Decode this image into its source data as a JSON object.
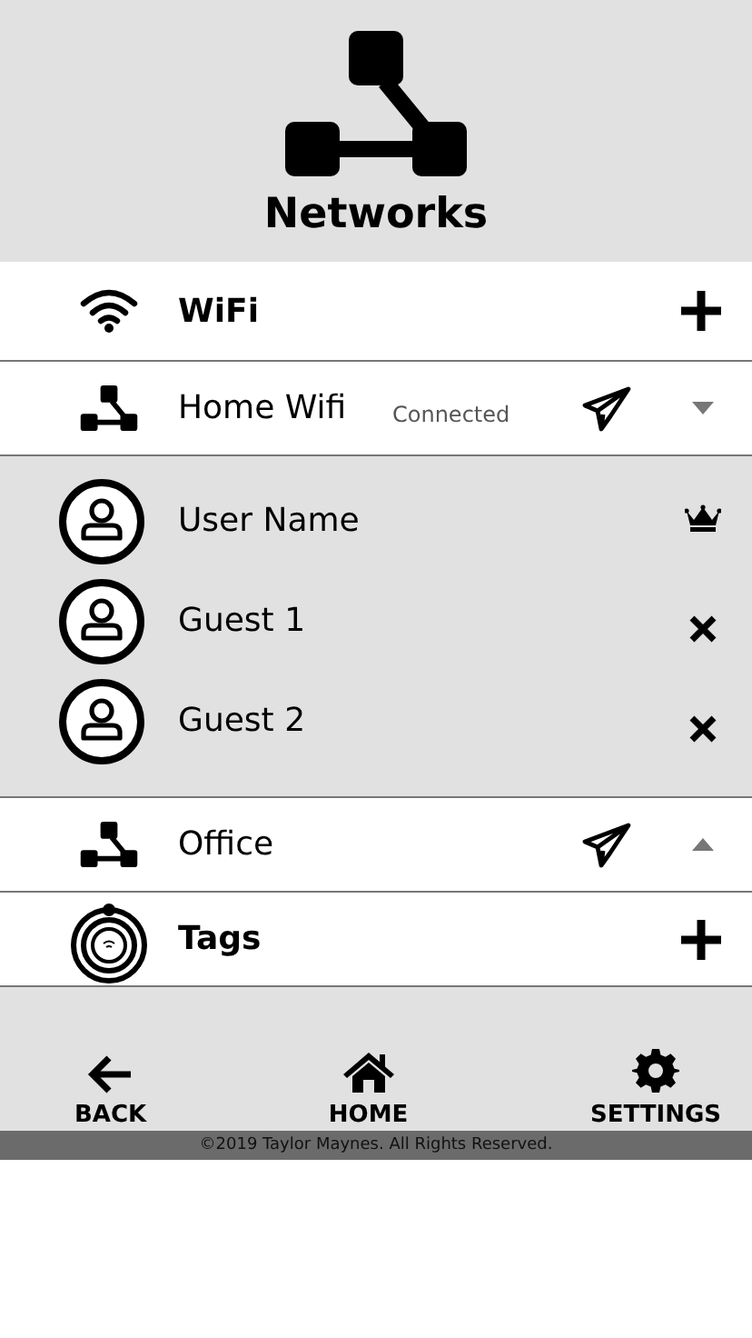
{
  "header": {
    "title": "Networks"
  },
  "wifi_section": {
    "label": "WiFi",
    "networks": [
      {
        "name": "Home Wifi",
        "status": "Connected",
        "expanded": true,
        "users": [
          {
            "name": "User Name",
            "kind": "owner"
          },
          {
            "name": "Guest 1",
            "kind": "guest"
          },
          {
            "name": "Guest 2",
            "kind": "guest"
          }
        ]
      },
      {
        "name": "Office",
        "expanded": false
      }
    ]
  },
  "tags_section": {
    "label": "Tags"
  },
  "nav": [
    {
      "label": "BACK"
    },
    {
      "label": "HOME"
    },
    {
      "label": "SETTINGS"
    }
  ],
  "copyright": "©2019 Taylor Maynes. All Rights Reserved."
}
